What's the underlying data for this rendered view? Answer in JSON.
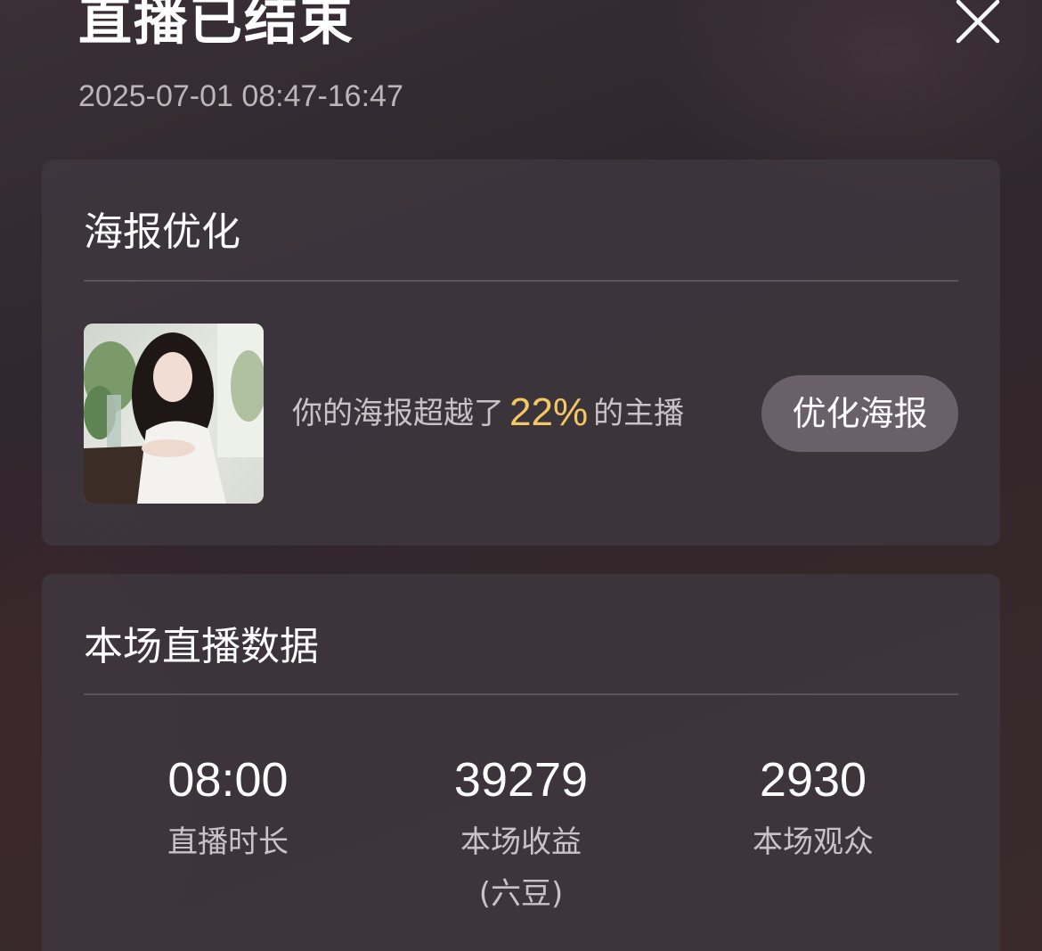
{
  "header": {
    "title": "直播已结束",
    "time_range": "2025-07-01 08:47-16:47"
  },
  "poster_card": {
    "title": "海报优化",
    "text_before": "你的海报超越了",
    "percent": "22%",
    "text_after": "的主播",
    "button_label": "优化海报"
  },
  "stats_card": {
    "title": "本场直播数据",
    "items": [
      {
        "value": "08:00",
        "label": "直播时长",
        "label2": ""
      },
      {
        "value": "39279",
        "label": "本场收益",
        "label2": "(六豆)"
      },
      {
        "value": "2930",
        "label": "本场观众",
        "label2": ""
      }
    ]
  },
  "colors": {
    "accent_percent": "#f3c862",
    "card_bg": "#403940",
    "button_bg": "#6a606a"
  },
  "icons": {
    "close": "close-icon"
  }
}
